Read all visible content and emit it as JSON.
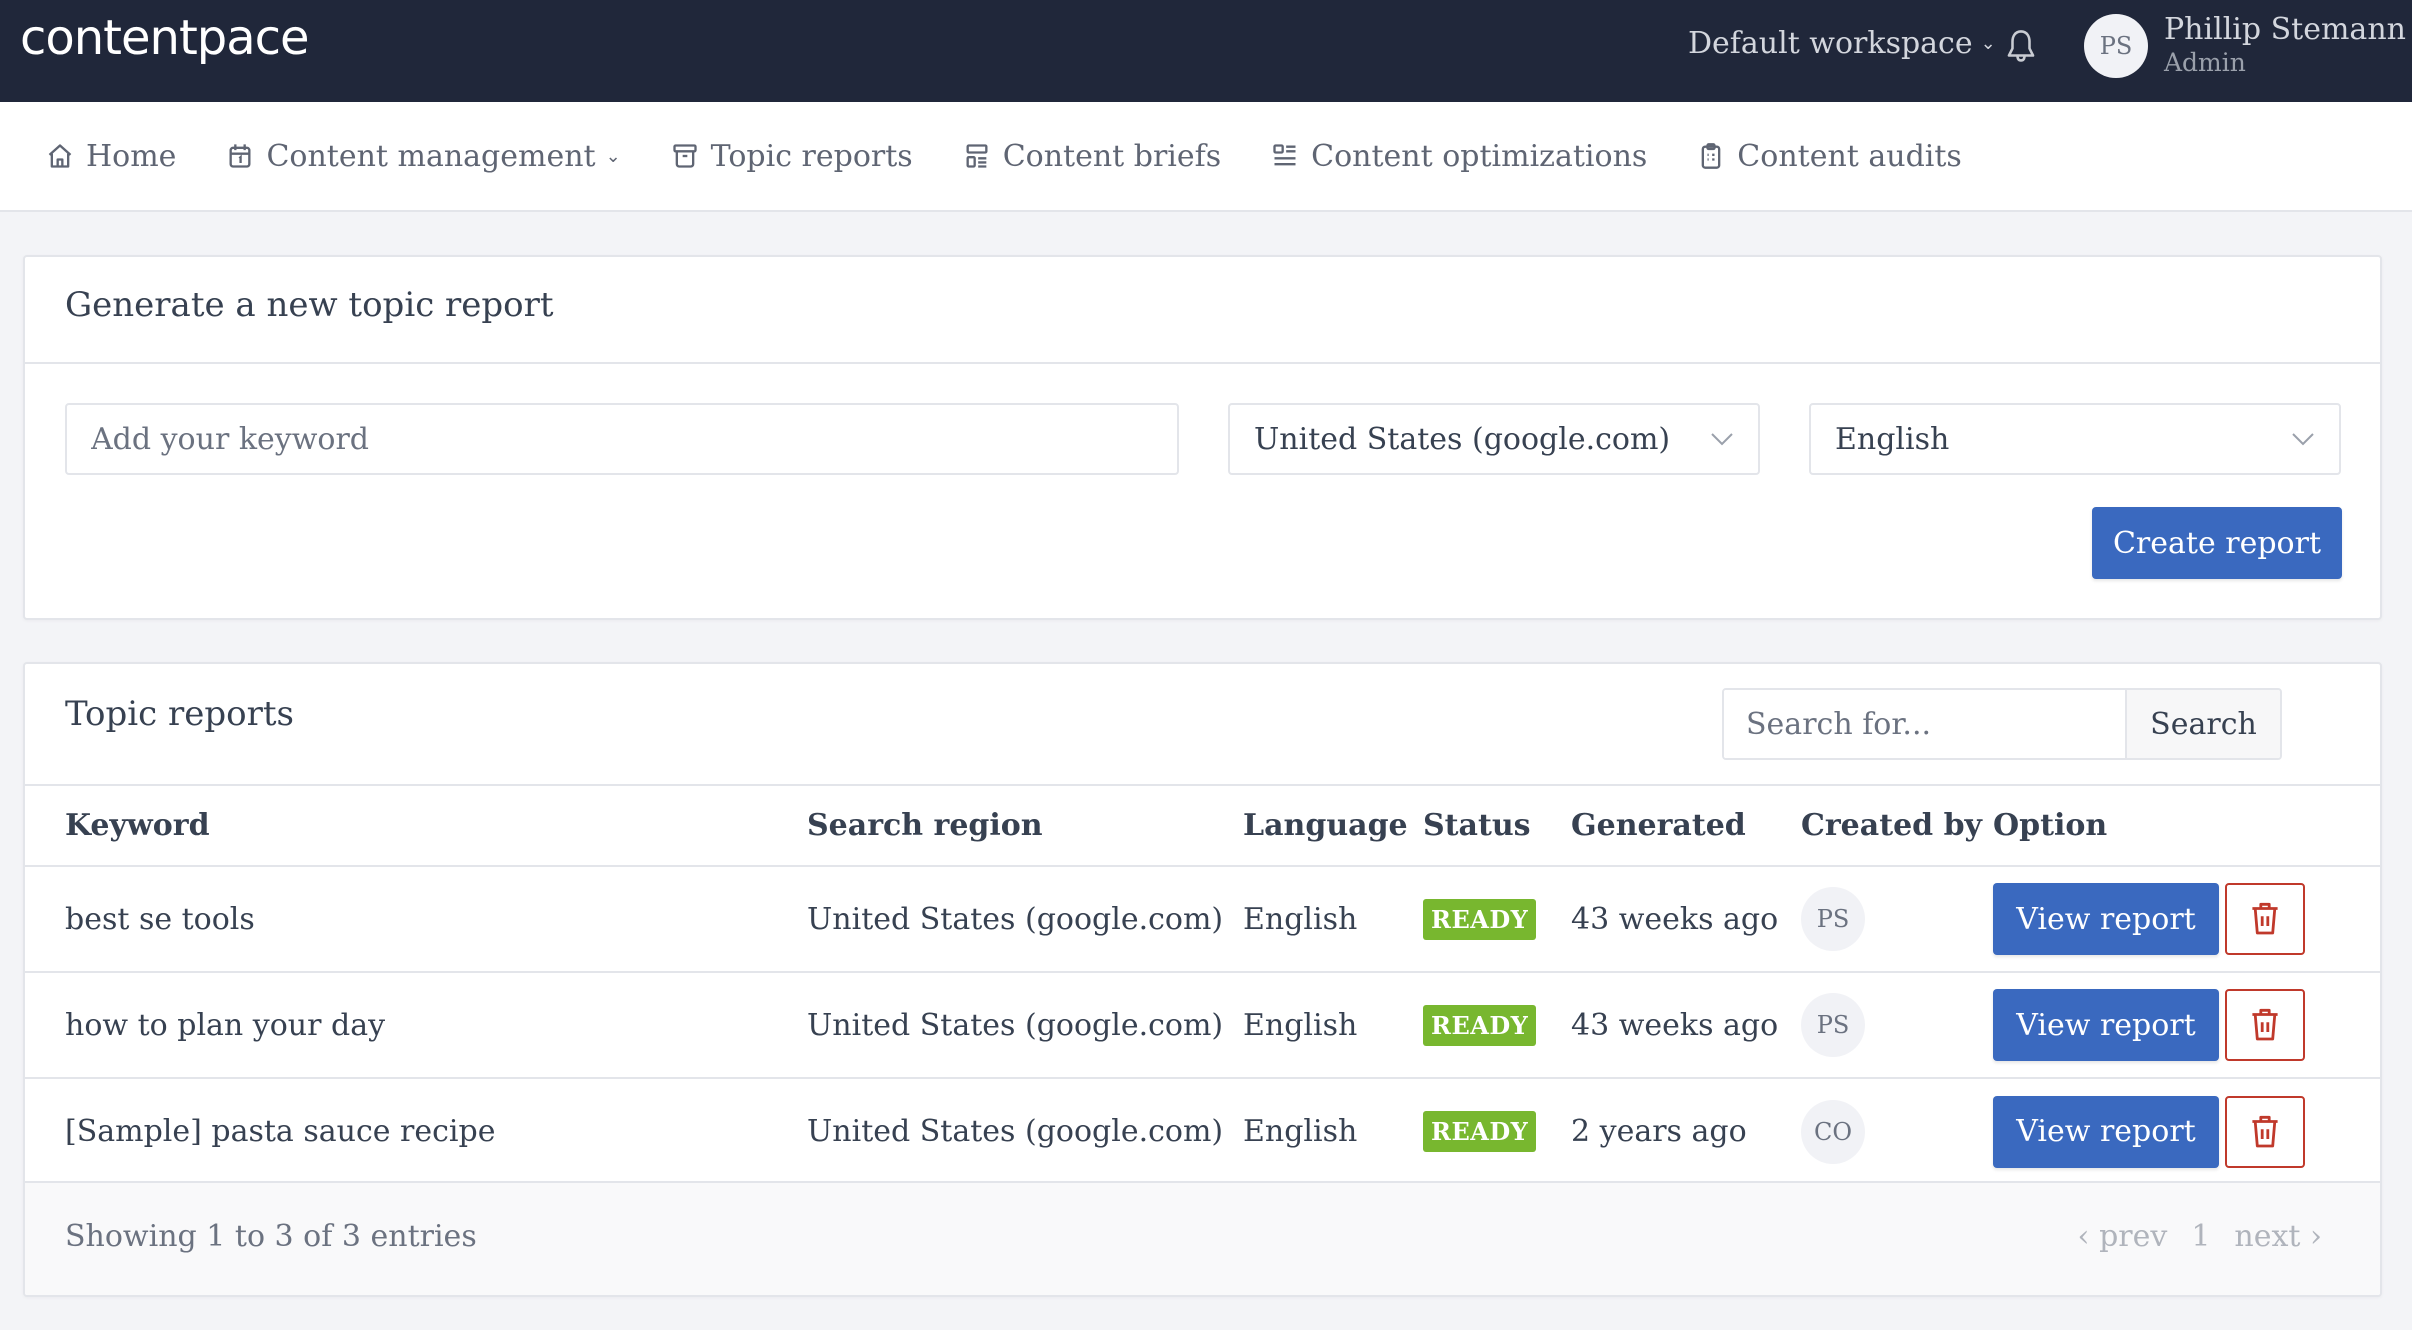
{
  "header": {
    "logo": "contentpace",
    "workspace": "Default workspace",
    "user": {
      "initials": "PS",
      "name": "Phillip Stemann",
      "role": "Admin"
    }
  },
  "nav": {
    "items": [
      {
        "label": "Home",
        "icon": "home-icon"
      },
      {
        "label": "Content management",
        "icon": "calendar-icon",
        "has_dropdown": true
      },
      {
        "label": "Topic reports",
        "icon": "archive-icon"
      },
      {
        "label": "Content briefs",
        "icon": "layout-list-icon"
      },
      {
        "label": "Content optimizations",
        "icon": "align-list-icon"
      },
      {
        "label": "Content audits",
        "icon": "clipboard-icon"
      }
    ]
  },
  "generate": {
    "title": "Generate a new topic report",
    "keyword_placeholder": "Add your keyword",
    "keyword_value": "",
    "region_selected": "United States (google.com)",
    "language_selected": "English",
    "create_label": "Create report"
  },
  "reports": {
    "title": "Topic reports",
    "search_placeholder": "Search for...",
    "search_label": "Search",
    "columns": [
      "Keyword",
      "Search region",
      "Language",
      "Status",
      "Generated",
      "Created by",
      "Option"
    ],
    "rows": [
      {
        "keyword": "best se tools",
        "region": "United States (google.com)",
        "language": "English",
        "status": "READY",
        "generated": "43 weeks ago",
        "created_by": "PS",
        "view_label": "View report"
      },
      {
        "keyword": "how to plan your day",
        "region": "United States (google.com)",
        "language": "English",
        "status": "READY",
        "generated": "43 weeks ago",
        "created_by": "PS",
        "view_label": "View report"
      },
      {
        "keyword": "[Sample] pasta sauce recipe",
        "region": "United States (google.com)",
        "language": "English",
        "status": "READY",
        "generated": "2 years ago",
        "created_by": "CO",
        "view_label": "View report"
      }
    ],
    "footer": {
      "showing": "Showing 1 to 3 of 3 entries",
      "prev": "‹ prev",
      "page": "1",
      "next": "next ›"
    }
  },
  "colors": {
    "header_bg": "#20273a",
    "primary": "#3a69bf",
    "ready": "#78b72f",
    "danger": "#c0392b"
  }
}
